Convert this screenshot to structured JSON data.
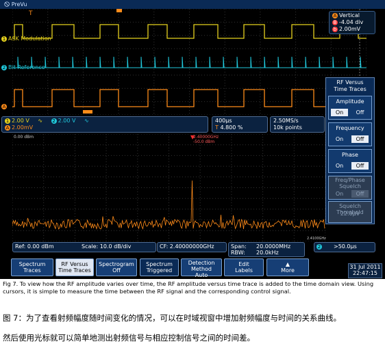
{
  "window": {
    "title": "PreVu"
  },
  "vertical_readout": {
    "label": "Vertical",
    "offset": "-4.04 div",
    "scale": "2.00mV"
  },
  "channels": {
    "ch1_label": "ASK Modulation",
    "ch2_label": "Bit Reference",
    "ch1_colour": "#e6d21e",
    "ch2_colour": "#20c8dc",
    "rf_colour": "#ff8c1a"
  },
  "status": {
    "ch1": "2.00 V",
    "ch2": "2.00 V",
    "ch_a": "2.00mV",
    "timebase": "400µs",
    "trigger_pos": "4.800 %",
    "sample_rate": "2.50MS/s",
    "record": "10k points"
  },
  "right_menu": {
    "title_line1": "RF Versus",
    "title_line2": "Time Traces",
    "amplitude": "Amplitude",
    "frequency": "Frequency",
    "phase": "Phase",
    "squelch": "Freq/Phase Squelch",
    "threshold_label": "Squelch Threshold",
    "threshold_value": "22.0µV",
    "on": "On",
    "off": "Off"
  },
  "freq_domain": {
    "ref_level_top": "0.00 dBm",
    "marker_freq": "2.40000GHz",
    "marker_level": "-50.0 dBm",
    "ref": "Ref: 0.00 dBm",
    "scale": "Scale: 10.0 dB/div",
    "cf": "CF: 2.40000000GHz",
    "span_label": "Span:",
    "span": "20.0000MHz",
    "rbw_label": "RBW:",
    "rbw": "20.0kHz",
    "right_edge": "2.4100GHz",
    "trigger": ">50.0µs"
  },
  "bottom_buttons": [
    {
      "l1": "Spectrum",
      "l2": "Traces"
    },
    {
      "l1": "RF Versus",
      "l2": "Time Traces"
    },
    {
      "l1": "Spectrogram",
      "l2": "Off"
    },
    {
      "l1": "Spectrum",
      "l2": "Triggered"
    },
    {
      "l1": "Detection Method",
      "l2": "Auto"
    },
    {
      "l1": "Edit",
      "l2": "Labels"
    },
    {
      "l1": "",
      "l2": "More"
    }
  ],
  "date": {
    "day": "31 Jul 2011",
    "time": "22:47:15"
  },
  "caption": "Fig 7. To view how the RF amplitude varies over time, the RF amplitude versus time trace is added to the time domain view. Using cursors, it is simple to measure the time between the RF signal and the corresponding control signal.",
  "chinese_line1": "图 7：为了查看射频幅度随时间变化的情况，可以在时域视窗中增加射频幅度与时间的关系曲线。",
  "chinese_line2": "然后使用光标就可以简单地测出射频信号与相应控制信号之间的时间差。"
}
